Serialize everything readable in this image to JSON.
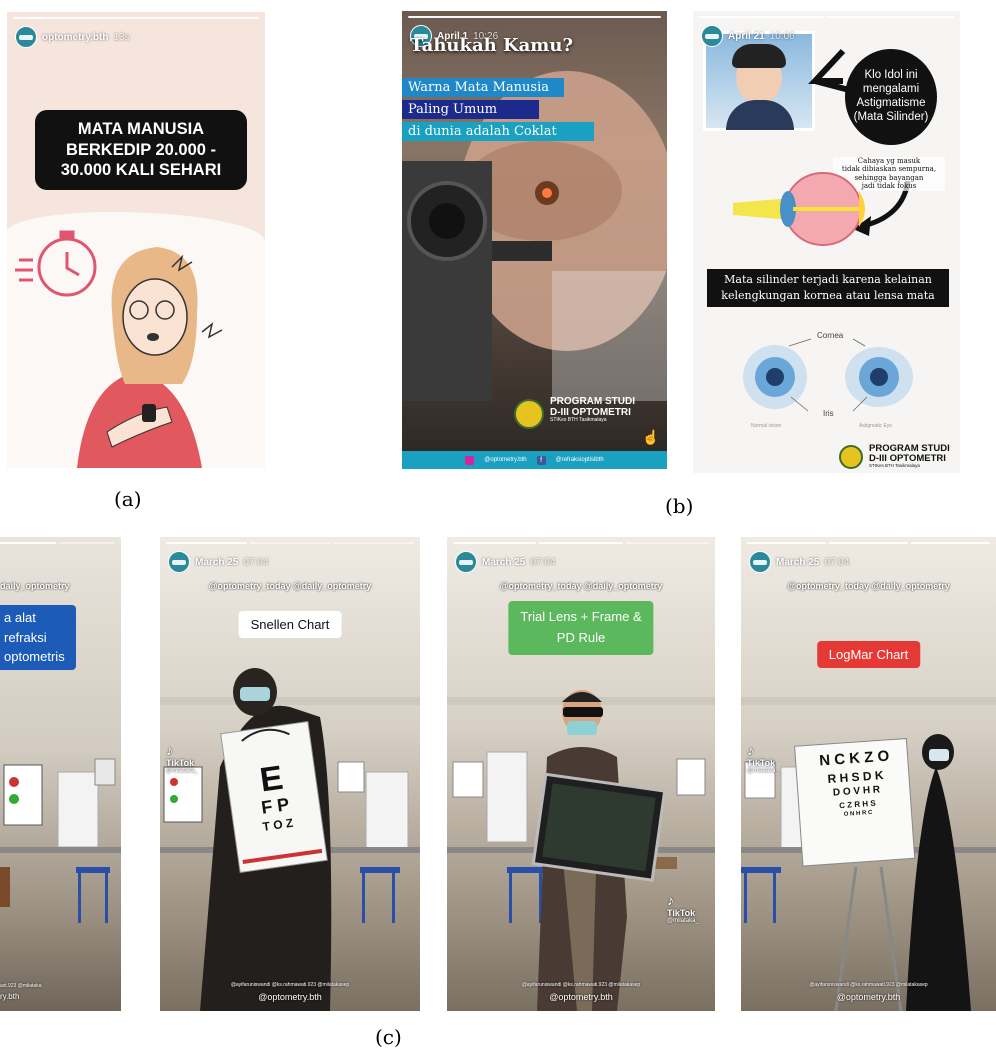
{
  "captions": {
    "a": "(a)",
    "b": "(b)",
    "c": "(c)"
  },
  "story_a": {
    "account": "optometry.bth",
    "time": "13s",
    "headline_lines": [
      "MATA MANUSIA",
      "BERKEDIP 20.000 -",
      "30.000 KALI SEHARI"
    ]
  },
  "story_b1": {
    "date": "April 1",
    "time": "10:26",
    "title": "Tahukah Kamu?",
    "lines": [
      "Warna Mata Manusia",
      "Paling Umum",
      "di dunia adalah Coklat"
    ],
    "program_lines": [
      "PROGRAM STUDI",
      "D-III OPTOMETRI"
    ],
    "program_sub": "STIKes BTH Tasikmalaya",
    "instagram": "@optometry.bth",
    "facebook": "@refraksioptisibth"
  },
  "story_b2": {
    "date": "April 21",
    "time": "10:06",
    "bubble_lines": [
      "Klo Idol ini",
      "mengalami",
      "Astigmatisme",
      "(Mata Silinder)"
    ],
    "note_lines": [
      "Cahaya yg masuk",
      "tidak dibiaskan sempurna,",
      "sehingga bayangan",
      "jadi tidak fokus"
    ],
    "banner_lines": [
      "Mata silinder terjadi karena kelainan",
      "kelengkungan kornea atau lensa mata"
    ],
    "cornea_label": "Cornea",
    "iris_label": "Iris",
    "normal_label": "Normal vision",
    "astig_label": "Astigmatic Eye",
    "program_lines": [
      "PROGRAM STUDI",
      "D-III OPTOMETRI"
    ],
    "program_sub": "STIKes BTH Tasikmalaya"
  },
  "story_c0": {
    "mention": "daily_optometry",
    "box_lines": [
      "a alat",
      "refraksi",
      "optometris"
    ],
    "footer_small": "ast.923 @milataka",
    "footer": "ry.bth"
  },
  "story_c1": {
    "date": "March 25",
    "time": "07:04",
    "mentions": "@optometry_today @daily_optometry",
    "label": "Snellen Chart",
    "tiktok": "TikTok",
    "tiktok_user": "@milataka_",
    "footer_small": "@ayifaruniswandi @ks.rahmawati.923 @milatakasep",
    "footer": "@optometry.bth",
    "chart_letters": [
      "E",
      "F P",
      "T O Z"
    ]
  },
  "story_c2": {
    "date": "March 25",
    "time": "07:04",
    "mentions": "@optometry_today @daily_optometry",
    "label_lines": [
      "Trial Lens + Frame &",
      "PD Rule"
    ],
    "tiktok": "TikTok",
    "tiktok_user": "@milataka_",
    "footer_small": "@ayifaruniswandi @ks.rahmawati.923 @milatakasep",
    "footer": "@optometry.bth"
  },
  "story_c3": {
    "date": "March 25",
    "time": "07:04",
    "mentions": "@optometry_today @daily_optometry",
    "label": "LogMar Chart",
    "tiktok": "TikTok",
    "tiktok_user": "@milataka_",
    "footer_small": "@ayifaruniswandi @ks.rahmawati.923 @milatakasep",
    "footer": "@optometry.bth",
    "chart_rows": [
      "N C K Z O",
      "R H S D K",
      "D O V H R",
      "C Z R H S",
      "O N H R C"
    ]
  },
  "colors": {
    "blue_label": "#1e88c8",
    "navy_label": "#1c2a8c",
    "green_label": "#5cb85c",
    "red_label": "#e53935",
    "cyan_bar": "#1aa0c0"
  }
}
